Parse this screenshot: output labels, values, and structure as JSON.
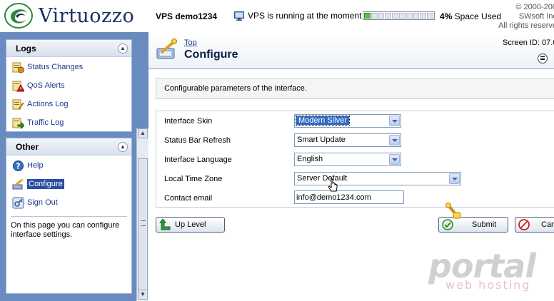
{
  "header": {
    "brand": "Virtuozzo",
    "vps_name": "VPS demo1234",
    "status_text": "VPS is running at the moment",
    "space_percent": "4%",
    "space_label": " Space Used",
    "space_fraction": 0.1,
    "copyright_lines": [
      "© 2000-200",
      "SWsoft Inc",
      "All rights reserve"
    ]
  },
  "sidebar": {
    "logs": {
      "title": "Logs",
      "items": [
        {
          "label": "Status Changes",
          "icon": "status-changes-icon"
        },
        {
          "label": "QoS Alerts",
          "icon": "qos-alerts-icon"
        },
        {
          "label": "Actions Log",
          "icon": "actions-log-icon"
        },
        {
          "label": "Traffic Log",
          "icon": "traffic-log-icon"
        }
      ]
    },
    "other": {
      "title": "Other",
      "items": [
        {
          "label": "Help",
          "icon": "help-icon"
        },
        {
          "label": "Configure",
          "icon": "configure-icon"
        },
        {
          "label": "Sign Out",
          "icon": "sign-out-icon"
        }
      ],
      "hint": "On this page you can configure interface settings."
    }
  },
  "main": {
    "breadcrumb": "Top",
    "title": "Configure",
    "screen_id": "Screen ID: 07.0",
    "description": "Configurable parameters of the interface.",
    "fields": [
      {
        "label": "Interface Skin",
        "value": "Modern Silver"
      },
      {
        "label": "Status Bar Refresh",
        "value": "Smart Update"
      },
      {
        "label": "Interface Language",
        "value": "English"
      },
      {
        "label": "Local Time Zone",
        "value": "Server Default"
      },
      {
        "label": "Contact email",
        "value": "info@demo1234.com"
      }
    ],
    "buttons": {
      "up_level": "Up Level",
      "submit": "Submit",
      "cancel": "Can"
    }
  },
  "watermark": {
    "word": "portal",
    "sub": "web hosting"
  },
  "colors": {
    "sidebar_bg": "#6a8bbf",
    "link": "#1e3a8a",
    "selected_option": "#316ac5"
  }
}
